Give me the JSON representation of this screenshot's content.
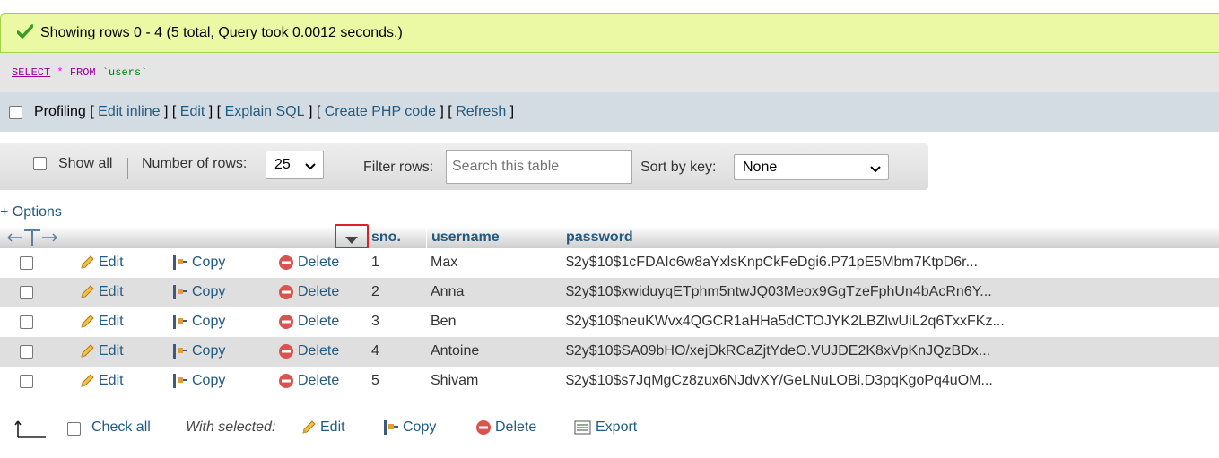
{
  "success_message": "Showing rows 0 - 4 (5 total, Query took 0.0012 seconds.)",
  "sql": {
    "select": "SELECT",
    "star": "*",
    "from": "FROM",
    "table": "`users`"
  },
  "profiling": {
    "label": "Profiling",
    "links": [
      "Edit inline",
      "Edit",
      "Explain SQL",
      "Create PHP code",
      "Refresh"
    ]
  },
  "nav": {
    "show_all": "Show all",
    "rows_label": "Number of rows:",
    "rows_value": "25",
    "filter_label": "Filter rows:",
    "filter_placeholder": "Search this table",
    "sort_label": "Sort by key:",
    "sort_value": "None"
  },
  "options_link": "+ Options",
  "columns": [
    "sno.",
    "username",
    "password"
  ],
  "actions": {
    "edit": "Edit",
    "copy": "Copy",
    "delete": "Delete"
  },
  "rows": [
    {
      "sno": "1",
      "username": "Max",
      "password": "$2y$10$1cFDAIc6w8aYxlsKnpCkFeDgi6.P71pE5Mbm7KtpD6r..."
    },
    {
      "sno": "2",
      "username": "Anna",
      "password": "$2y$10$xwiduyqETphm5ntwJQ03Meox9GgTzeFphUn4bAcRn6Y..."
    },
    {
      "sno": "3",
      "username": "Ben",
      "password": "$2y$10$neuKWvx4QGCR1aHHa5dCTOJYK2LBZlwUiL2q6TxxFKz..."
    },
    {
      "sno": "4",
      "username": "Antoine",
      "password": "$2y$10$SA09bHO/xejDkRCaZjtYdeO.VUJDE2K8xVpKnJQzBDx..."
    },
    {
      "sno": "5",
      "username": "Shivam",
      "password": "$2y$10$s7JqMgCz8zux6NJdvXY/GeLNuLOBi.D3pqKgoPq4uOM..."
    }
  ],
  "footer": {
    "check_all": "Check all",
    "with_selected": "With selected:",
    "edit": "Edit",
    "copy": "Copy",
    "delete": "Delete",
    "export": "Export"
  },
  "colors": {
    "link": "#235a81",
    "success_bg": "#ebf8a4",
    "row_alt": "#dfdfdf"
  },
  "icons": [
    "check-icon",
    "pencil-icon",
    "copy-icon",
    "delete-icon",
    "export-icon",
    "sort-arrow-icon",
    "column-resize-icon",
    "arrow-up-left-icon"
  ]
}
